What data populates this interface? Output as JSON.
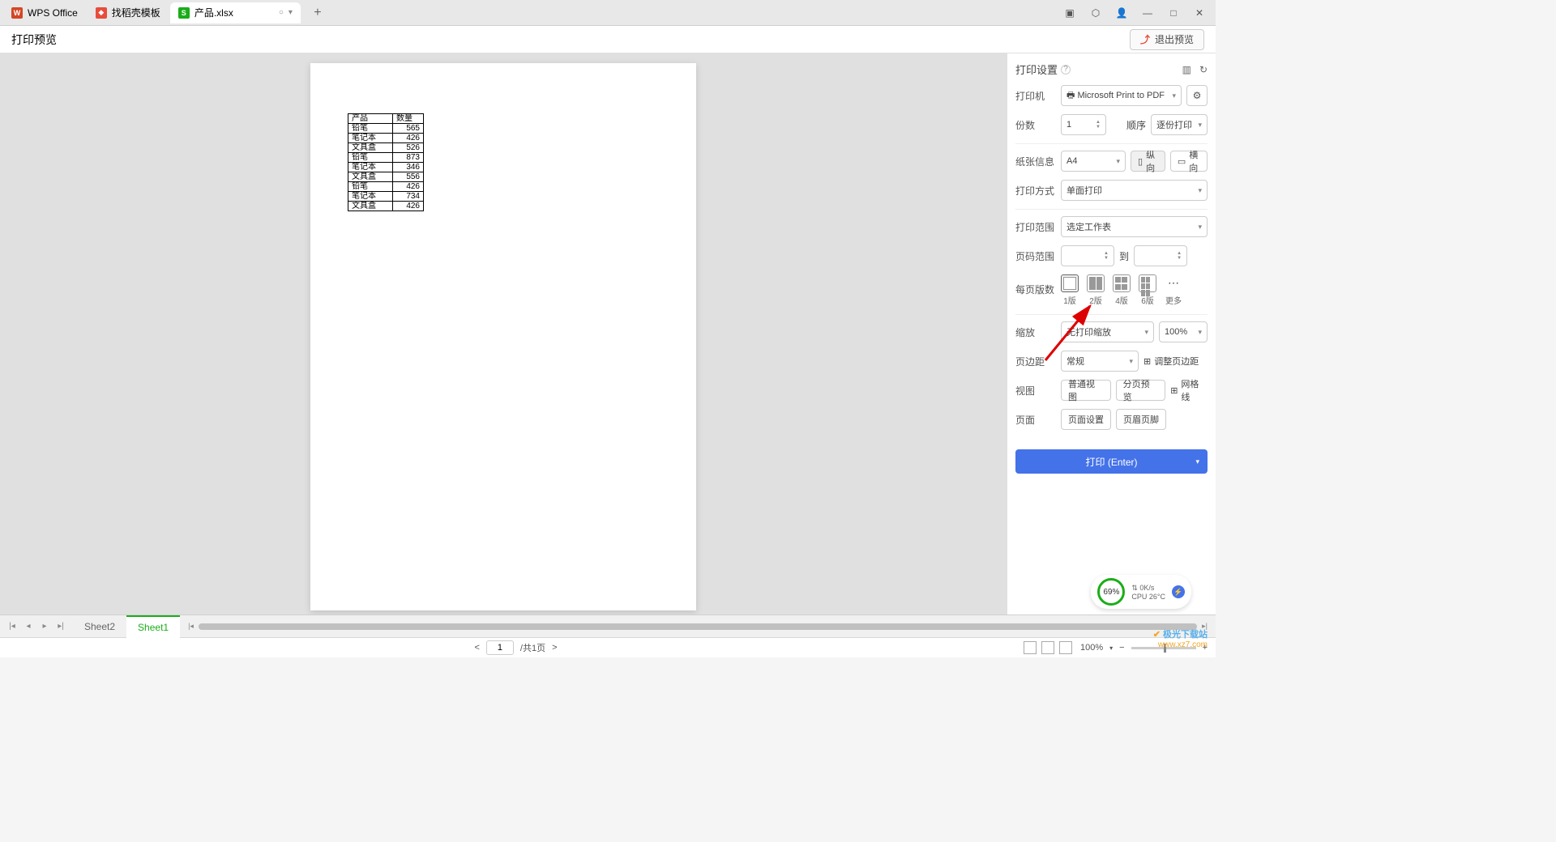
{
  "tabs": {
    "wps": "WPS Office",
    "template": "找稻壳模板",
    "file": "产品.xlsx"
  },
  "header": {
    "title": "打印预览",
    "exit": "退出预览"
  },
  "table": {
    "headers": [
      "产品",
      "数量"
    ],
    "rows": [
      [
        "铅笔",
        "565"
      ],
      [
        "笔记本",
        "426"
      ],
      [
        "文具盒",
        "526"
      ],
      [
        "铅笔",
        "873"
      ],
      [
        "笔记本",
        "346"
      ],
      [
        "文具盒",
        "556"
      ],
      [
        "铅笔",
        "426"
      ],
      [
        "笔记本",
        "734"
      ],
      [
        "文具盒",
        "426"
      ]
    ]
  },
  "settings": {
    "title": "打印设置",
    "printer_label": "打印机",
    "printer_value": "Microsoft Print to PDF",
    "copies_label": "份数",
    "copies_value": "1",
    "order_label": "顺序",
    "order_value": "逐份打印",
    "paper_label": "纸张信息",
    "paper_value": "A4",
    "portrait": "纵向",
    "landscape": "横向",
    "duplex_label": "打印方式",
    "duplex_value": "单面打印",
    "range_label": "打印范围",
    "range_value": "选定工作表",
    "page_range_label": "页码范围",
    "to": "到",
    "per_page_label": "每页版数",
    "layouts": [
      "1版",
      "2版",
      "4版",
      "6版",
      "更多"
    ],
    "scale_label": "缩放",
    "scale_value": "无打印缩放",
    "scale_percent": "100%",
    "margin_label": "页边距",
    "margin_value": "常规",
    "adjust_margin": "调整页边距",
    "view_label": "视图",
    "normal_view": "普通视图",
    "page_break": "分页预览",
    "gridlines": "网格线",
    "page_label": "页面",
    "page_setup": "页面设置",
    "header_footer": "页眉页脚",
    "print_btn": "打印 (Enter)"
  },
  "sheets": {
    "sheet2": "Sheet2",
    "sheet1": "Sheet1"
  },
  "status": {
    "current_page": "1",
    "total_pages": "/共1页",
    "zoom": "100%"
  },
  "perf": {
    "ring": "69%",
    "net": "0K/s",
    "cpu": "CPU 26°C"
  },
  "watermark": {
    "line1": "极光下载站",
    "line2": "www.xz7.com"
  }
}
